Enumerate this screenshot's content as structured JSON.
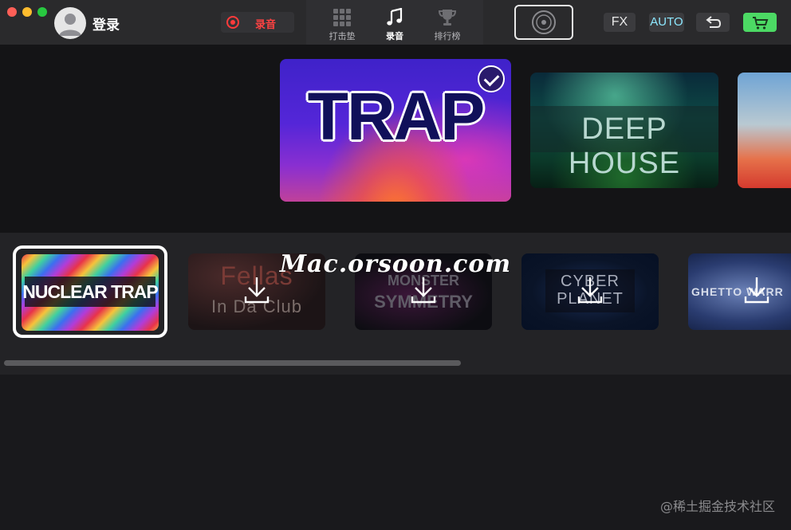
{
  "window": {
    "traffic_lights": [
      "close",
      "minimize",
      "zoom"
    ]
  },
  "account": {
    "login_label": "登录"
  },
  "record": {
    "label": "录音",
    "color": "#ff4242"
  },
  "nav": {
    "tabs": [
      {
        "label": "打击垫",
        "icon": "grid-icon",
        "active": false
      },
      {
        "label": "录音",
        "icon": "music-note-icon",
        "active": true
      },
      {
        "label": "排行榜",
        "icon": "trophy-icon",
        "active": false
      }
    ]
  },
  "toolbar": {
    "vinyl_icon": "vinyl-record-icon",
    "fx_label": "FX",
    "auto_label": "AUTO",
    "undo_icon": "undo-icon",
    "cart_icon": "cart-icon",
    "cart_color": "#4cd964",
    "auto_color": "#8de8ff"
  },
  "genres": {
    "items": [
      {
        "title": "TRAP",
        "selected": true
      },
      {
        "title": "DEEP HOUSE",
        "selected": false
      }
    ]
  },
  "packs": {
    "items": [
      {
        "title": "NUCLEAR TRAP",
        "selected": true,
        "downloaded": true
      },
      {
        "title_line1": "Fellas",
        "title_line2": "In Da Club",
        "downloaded": false
      },
      {
        "title_line1": "MONSTER",
        "title_line2": "SYMMETRY",
        "downloaded": false
      },
      {
        "title_line1": "CYBER",
        "title_line2": "PLANET",
        "downloaded": false
      },
      {
        "title": "GHETTO WARR",
        "downloaded": false
      }
    ]
  },
  "overlay": {
    "watermark": "Mac.orsoon.com",
    "credit": "@稀土掘金技术社区"
  }
}
